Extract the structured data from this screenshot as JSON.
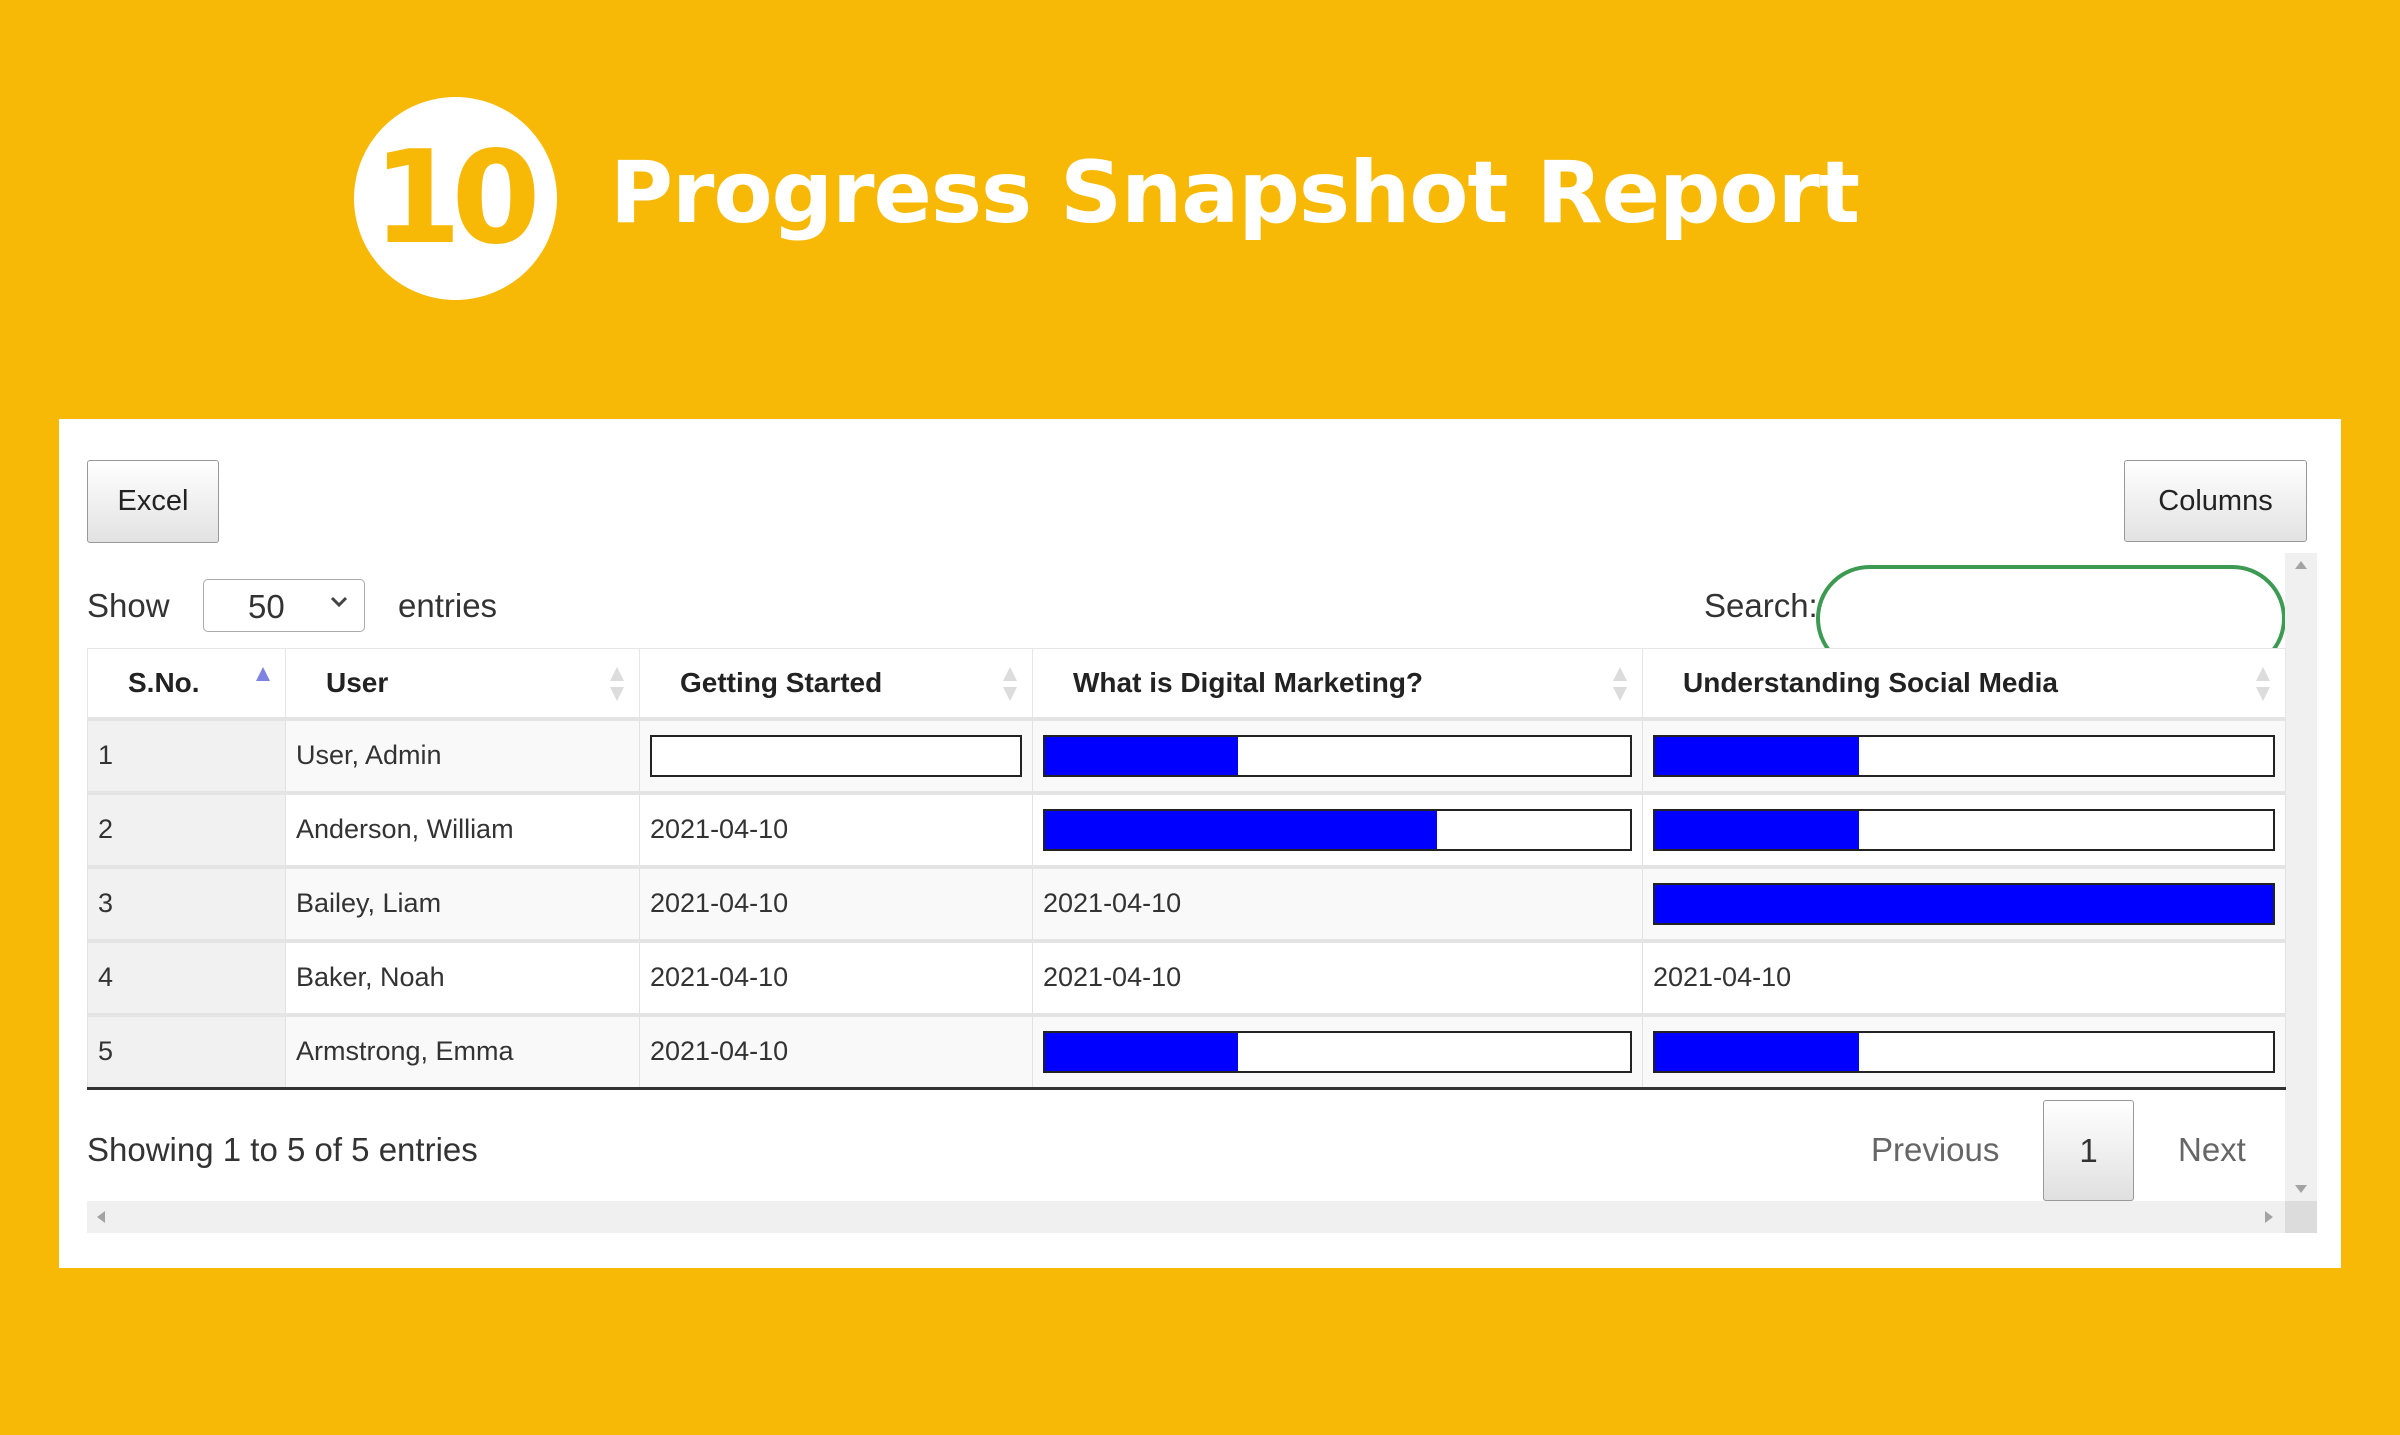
{
  "header": {
    "badge_number": "10",
    "title": "Progress Snapshot Report"
  },
  "colors": {
    "background": "#F7B906",
    "progress_fill": "#0000FF",
    "search_border": "#3D9A52",
    "sort_active": "#7F83E0"
  },
  "toolbar": {
    "excel_label": "Excel",
    "columns_label": "Columns"
  },
  "length": {
    "show_label": "Show",
    "selected": "50",
    "entries_label": "entries"
  },
  "search": {
    "label": "Search:",
    "value": "",
    "placeholder": ""
  },
  "table": {
    "columns": [
      {
        "label": "S.No.",
        "sort": "asc"
      },
      {
        "label": "User",
        "sort": "none"
      },
      {
        "label": "Getting Started",
        "sort": "none"
      },
      {
        "label": "What is Digital Marketing?",
        "sort": "none"
      },
      {
        "label": "Understanding Social Media",
        "sort": "none"
      }
    ],
    "rows": [
      {
        "sno": "1",
        "user": "User, Admin",
        "cells": [
          {
            "type": "progress",
            "percent": 0
          },
          {
            "type": "progress",
            "percent": 33
          },
          {
            "type": "progress",
            "percent": 33
          }
        ]
      },
      {
        "sno": "2",
        "user": "Anderson, William",
        "cells": [
          {
            "type": "date",
            "text": "2021-04-10"
          },
          {
            "type": "progress",
            "percent": 67
          },
          {
            "type": "progress",
            "percent": 33
          }
        ]
      },
      {
        "sno": "3",
        "user": "Bailey, Liam",
        "cells": [
          {
            "type": "date",
            "text": "2021-04-10"
          },
          {
            "type": "date",
            "text": "2021-04-10"
          },
          {
            "type": "progress",
            "percent": 100
          }
        ]
      },
      {
        "sno": "4",
        "user": "Baker, Noah",
        "cells": [
          {
            "type": "date",
            "text": "2021-04-10"
          },
          {
            "type": "date",
            "text": "2021-04-10"
          },
          {
            "type": "date",
            "text": "2021-04-10"
          }
        ]
      },
      {
        "sno": "5",
        "user": "Armstrong, Emma",
        "cells": [
          {
            "type": "date",
            "text": "2021-04-10"
          },
          {
            "type": "progress",
            "percent": 33
          },
          {
            "type": "progress",
            "percent": 33
          }
        ]
      }
    ]
  },
  "footer": {
    "info": "Showing 1 to 5 of 5 entries",
    "previous_label": "Previous",
    "current_page": "1",
    "next_label": "Next"
  }
}
